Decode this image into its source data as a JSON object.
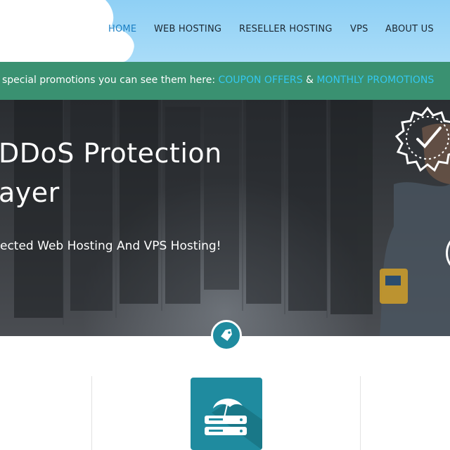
{
  "nav": {
    "items": [
      {
        "label": "HOME",
        "active": true
      },
      {
        "label": "WEB HOSTING",
        "active": false
      },
      {
        "label": "RESELLER HOSTING",
        "active": false
      },
      {
        "label": "VPS",
        "active": false
      },
      {
        "label": "ABOUT US",
        "active": false
      }
    ]
  },
  "promo": {
    "text": "special promotions you can see them here: ",
    "coupon_link": "COUPON OFFERS",
    "separator": " & ",
    "monthly_link": "MONTHLY PROMOTIONS"
  },
  "hero": {
    "title_line1": "DDoS Protection",
    "title_line2": "ayer",
    "subtitle": "ected Web Hosting And VPS Hosting!"
  },
  "colors": {
    "header_sky": "#a9dcf8",
    "promo_bg": "#3a9171",
    "link": "#34c8f0",
    "nav_active": "#1a7fc4",
    "accent_teal": "#1f8b9f"
  },
  "icons": {
    "badge": "verified-check-badge-icon",
    "tag": "price-tag-icon",
    "feature": "umbrella-server-icon"
  }
}
